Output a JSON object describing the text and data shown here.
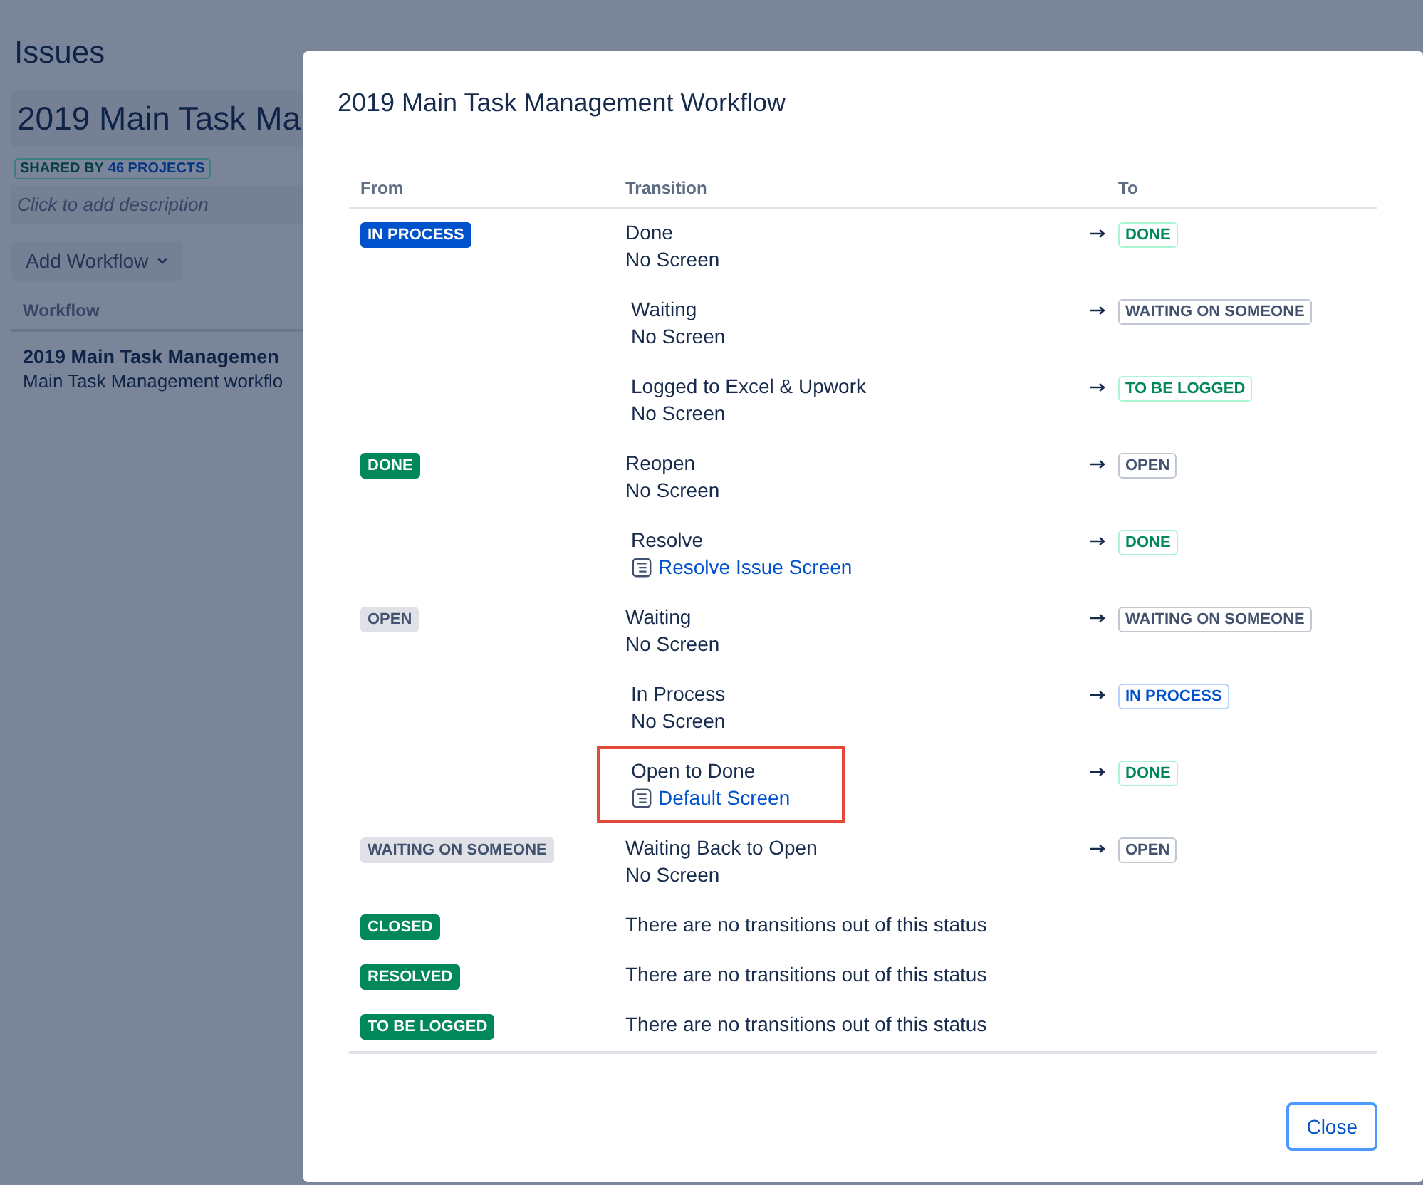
{
  "background": {
    "title": "Issues",
    "workflow_heading": "2019 Main Task Ma",
    "shared_label": "SHARED BY",
    "shared_count": "46 PROJECTS",
    "description_placeholder": "Click to add description",
    "add_button": "Add Workflow",
    "table_header": "Workflow",
    "row_name": "2019 Main Task Managemen",
    "row_description": "Main Task Management workflo"
  },
  "dialog": {
    "title": "2019 Main Task Management Workflow",
    "columns": [
      "From",
      "Transition",
      "To"
    ],
    "statuses": [
      {
        "name": "IN PROCESS",
        "kind": "inprogress",
        "transitions": [
          {
            "name": "Done",
            "screen": {
              "text": "No Screen",
              "link": false
            },
            "to": {
              "name": "DONE",
              "kind": "done"
            },
            "highlighted": false
          },
          {
            "name": "Waiting",
            "screen": {
              "text": "No Screen",
              "link": false
            },
            "to": {
              "name": "WAITING ON SOMEONE",
              "kind": "new"
            },
            "highlighted": false
          },
          {
            "name": "Logged to Excel & Upwork",
            "screen": {
              "text": "No Screen",
              "link": false
            },
            "to": {
              "name": "TO BE LOGGED",
              "kind": "done"
            },
            "highlighted": false
          }
        ]
      },
      {
        "name": "DONE",
        "kind": "done",
        "transitions": [
          {
            "name": "Reopen",
            "screen": {
              "text": "No Screen",
              "link": false
            },
            "to": {
              "name": "OPEN",
              "kind": "new"
            },
            "highlighted": false
          },
          {
            "name": "Resolve",
            "screen": {
              "text": "Resolve Issue Screen",
              "link": true
            },
            "to": {
              "name": "DONE",
              "kind": "done"
            },
            "highlighted": false
          }
        ]
      },
      {
        "name": "OPEN",
        "kind": "new",
        "transitions": [
          {
            "name": "Waiting",
            "screen": {
              "text": "No Screen",
              "link": false
            },
            "to": {
              "name": "WAITING ON SOMEONE",
              "kind": "new"
            },
            "highlighted": false
          },
          {
            "name": "In Process",
            "screen": {
              "text": "No Screen",
              "link": false
            },
            "to": {
              "name": "IN PROCESS",
              "kind": "inprogress"
            },
            "highlighted": false
          },
          {
            "name": "Open to Done",
            "screen": {
              "text": "Default Screen",
              "link": true
            },
            "to": {
              "name": "DONE",
              "kind": "done"
            },
            "highlighted": true
          }
        ]
      },
      {
        "name": "WAITING ON SOMEONE",
        "kind": "new",
        "transitions": [
          {
            "name": "Waiting Back to Open",
            "screen": {
              "text": "No Screen",
              "link": false
            },
            "to": {
              "name": "OPEN",
              "kind": "new"
            },
            "highlighted": false
          }
        ]
      },
      {
        "name": "CLOSED",
        "kind": "done",
        "empty_message": "There are no transitions out of this status"
      },
      {
        "name": "RESOLVED",
        "kind": "done",
        "empty_message": "There are no transitions out of this status"
      },
      {
        "name": "TO BE LOGGED",
        "kind": "done",
        "empty_message": "There are no transitions out of this status"
      }
    ],
    "close_button": "Close"
  }
}
